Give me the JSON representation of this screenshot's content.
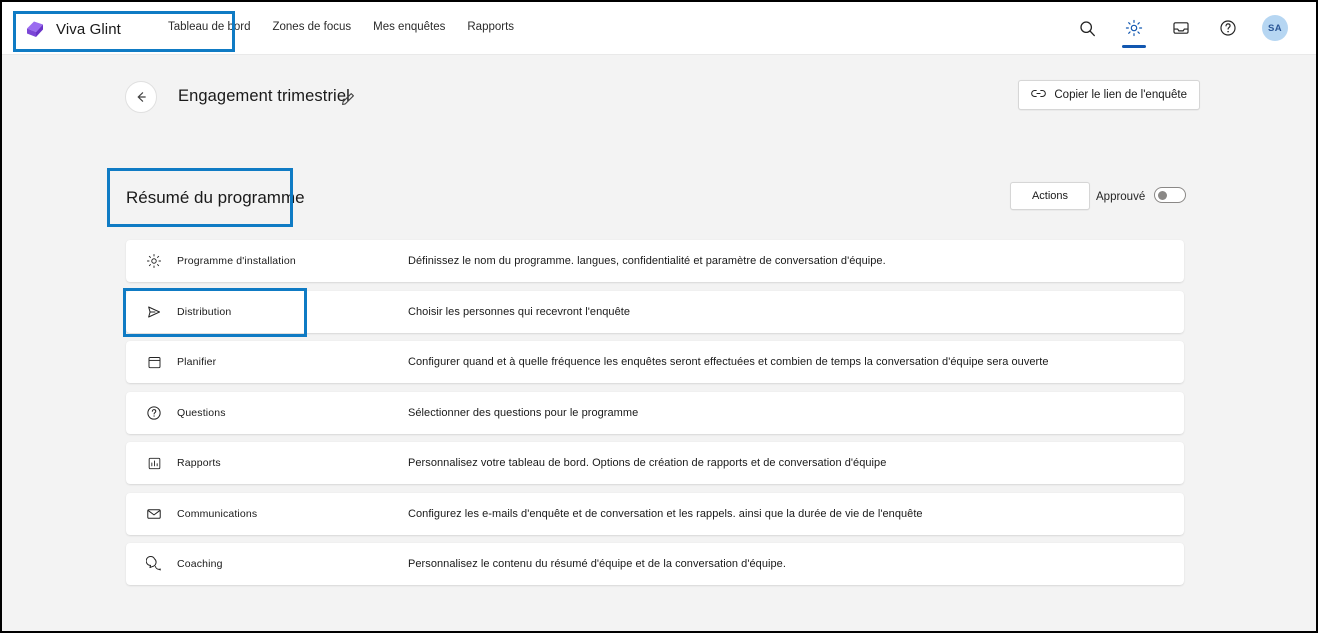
{
  "app": {
    "brand_name": "Viva Glint",
    "logo_icon": "viva-glint-logo",
    "accent_color": "#1257b0",
    "annotation_color": "#0f7bc4",
    "logo_color": "#8a5cf5"
  },
  "nav": {
    "items": [
      {
        "label": "Tableau de bord",
        "icon": "dashboard-nav"
      },
      {
        "label": "Zones de focus",
        "icon": "focus-areas-nav"
      },
      {
        "label": "Mes enquêtes",
        "icon": "my-surveys-nav"
      },
      {
        "label": "Rapports",
        "icon": "reports-nav"
      }
    ]
  },
  "top_icons": {
    "search": "search-icon",
    "settings": "gear-icon",
    "inbox": "inbox-icon",
    "help": "help-icon",
    "avatar_initials": "SA"
  },
  "subheader": {
    "back_icon": "back-arrow-icon",
    "page_title": "Engagement trimestriel",
    "edit_icon": "pencil-icon",
    "copy_link_label": "Copier le lien de l'enquête",
    "copy_link_icon": "link-icon"
  },
  "content": {
    "section_title": "Résumé du programme",
    "actions_label": "Actions",
    "approved_label": "Approuvé",
    "toggle_state": "off"
  },
  "cards": [
    {
      "icon": "gear-icon",
      "label": "Programme d'installation",
      "description": "Définissez le nom du programme. langues, confidentialité et paramètre de conversation d'équipe."
    },
    {
      "icon": "send-icon",
      "label": "Distribution",
      "description": "Choisir les personnes qui recevront l'enquête"
    },
    {
      "icon": "calendar-icon",
      "label": "Planifier",
      "description": "Configurer quand et à quelle fréquence les enquêtes seront effectuées et combien de temps la conversation d'équipe sera ouverte"
    },
    {
      "icon": "question-circle-icon",
      "label": "Questions",
      "description": "Sélectionner des questions pour le programme"
    },
    {
      "icon": "bar-chart-icon",
      "label": "Rapports",
      "description": "Personnalisez votre tableau de bord. Options de création de rapports et de conversation d'équipe"
    },
    {
      "icon": "envelope-icon",
      "label": "Communications",
      "description": "Configurez les e-mails d'enquête et de conversation et les rappels. ainsi que la durée de vie de l'enquête"
    },
    {
      "icon": "chat-bubble-icon",
      "label": "Coaching",
      "description": "Personnalisez le contenu du résumé d'équipe et de la conversation d'équipe."
    }
  ]
}
